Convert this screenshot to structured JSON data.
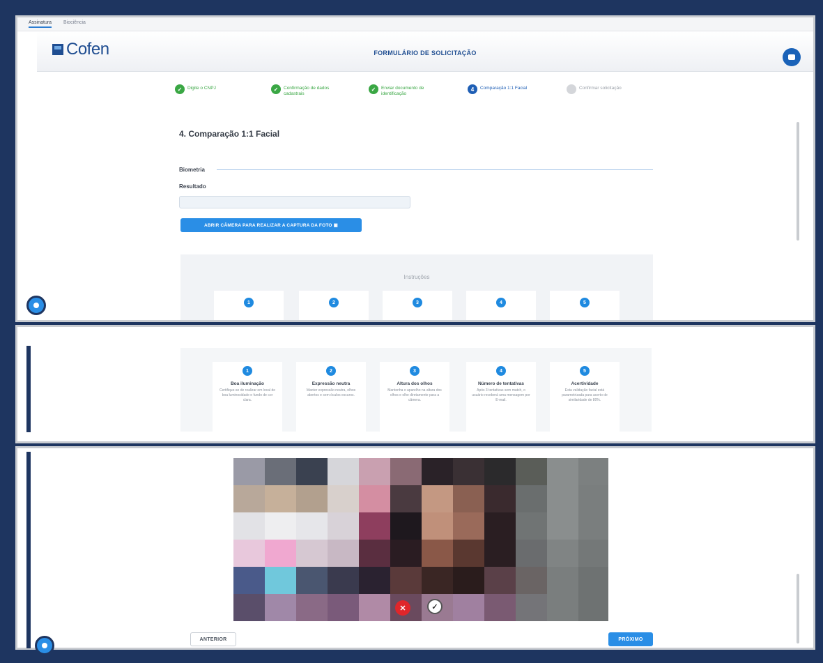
{
  "tabs": [
    "Assinatura",
    "Biociência"
  ],
  "header": {
    "logo_text": "Cofen",
    "title": "FORMULÁRIO DE SOLICITAÇÃO"
  },
  "steps": [
    {
      "label": "Digite o CNPJ",
      "status": "done"
    },
    {
      "label": "Confirmação de dados cadastrais",
      "status": "done"
    },
    {
      "label": "Enviar documento de identificação",
      "status": "done"
    },
    {
      "label": "Comparação 1:1 Facial",
      "status": "current",
      "number": "4"
    },
    {
      "label": "Confirmar solicitação",
      "status": "pending"
    }
  ],
  "section": {
    "title": "4. Comparação 1:1 Facial",
    "biometria_label": "Biometria",
    "resultado_label": "Resultado",
    "camera_button": "ABRIR CÂMERA PARA REALIZAR A CAPTURA DA FOTO ▣"
  },
  "instructions": {
    "title": "Instruções",
    "cards": [
      {
        "number": "1",
        "title": "Boa iluminação",
        "text": "Certifique-se de realizar em local de boa luminosidade e fundo de cor clara."
      },
      {
        "number": "2",
        "title": "Expressão neutra",
        "text": "Manter expressão neutra, olhos abertos e sem óculos escuros."
      },
      {
        "number": "3",
        "title": "Altura dos olhos",
        "text": "Mantenha o aparelho na altura dos olhos e olhe diretamente para a câmera."
      },
      {
        "number": "4",
        "title": "Número de tentativas",
        "text": "Após 3 tentativas sem match, o usuário receberá uma mensagem por E-mail."
      },
      {
        "number": "5",
        "title": "Acertividade",
        "text": "Esta validação facial está parametrizada para acerto de similaridade de 80%."
      }
    ]
  },
  "camera": {
    "cancel_symbol": "✕",
    "confirm_symbol": "✓"
  },
  "nav": {
    "previous": "ANTERIOR",
    "next": "PRÓXIMO"
  },
  "colors": {
    "brand": "#1f4d91",
    "accent": "#2a8ee6",
    "done": "#3aa744",
    "frame": "#1e3560"
  },
  "icons": [
    "check-icon",
    "chat-icon",
    "camera-icon",
    "close-icon"
  ]
}
